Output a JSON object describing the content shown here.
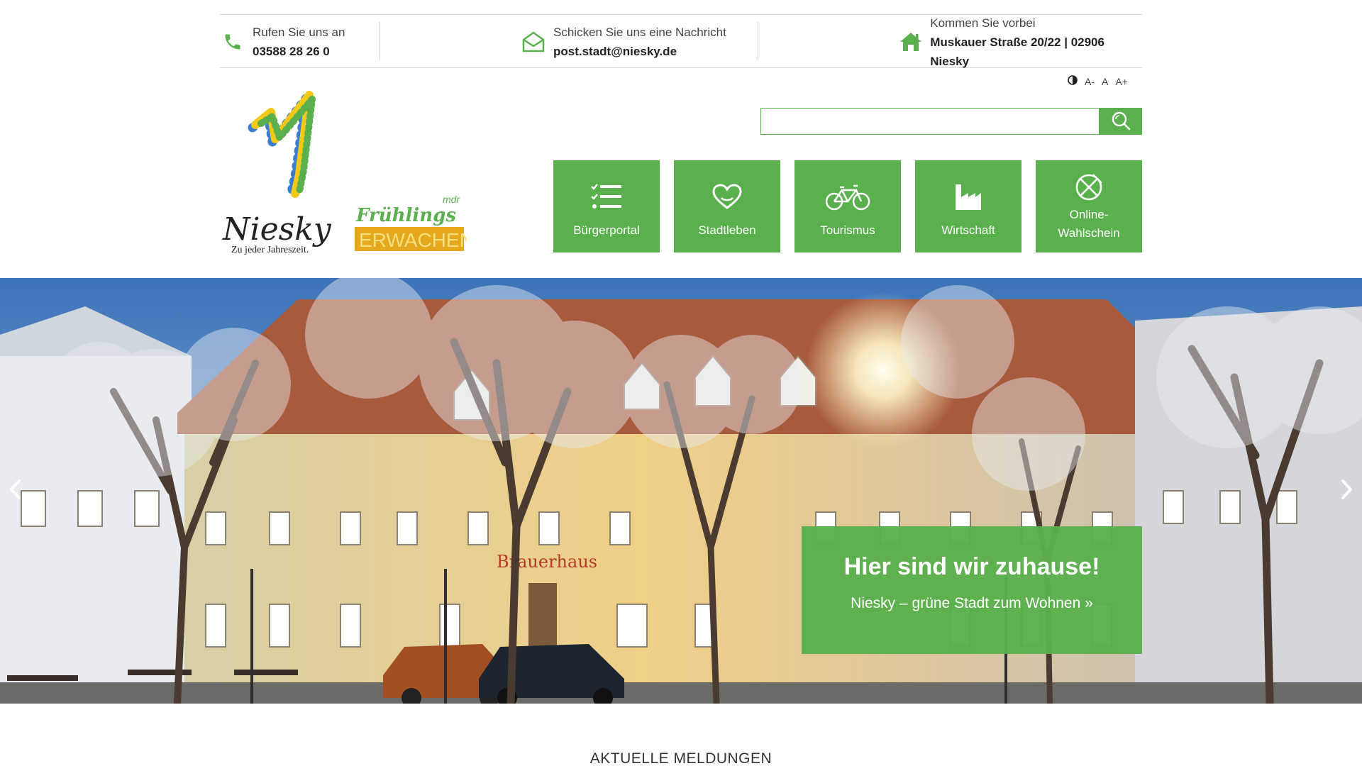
{
  "contact": {
    "phone": {
      "label": "Rufen Sie uns an",
      "value": "03588 28 26 0",
      "icon": "phone-icon"
    },
    "email": {
      "label": "Schicken Sie uns eine Nachricht",
      "value": "post.stadt@niesky.de",
      "icon": "envelope-icon"
    },
    "address": {
      "label": "Kommen Sie vorbei",
      "value": "Muskauer Straße 20/22 | 02906 Niesky",
      "icon": "home-icon"
    }
  },
  "accessibility": {
    "contrast_icon": "contrast-icon",
    "smaller": "A-",
    "normal": "A",
    "larger": "A+"
  },
  "logo": {
    "name": "Niesky",
    "tagline": "Zu jeder Jahreszeit."
  },
  "campaign_logo": {
    "top": "mdr",
    "word1": "Frühlings",
    "word2": "ERWACHEN"
  },
  "search": {
    "placeholder": "",
    "value": ""
  },
  "tiles": [
    {
      "label": "Bürgerportal",
      "icon": "checklist-icon"
    },
    {
      "label": "Stadtleben",
      "icon": "heart-icon"
    },
    {
      "label": "Tourismus",
      "icon": "bicycle-icon"
    },
    {
      "label": "Wirtschaft",
      "icon": "factory-icon"
    },
    {
      "label": "Online-Wahlschein",
      "line1": "Online-",
      "line2": "Wahlschein",
      "icon": "ballot-icon"
    }
  ],
  "hero": {
    "title": "Hier sind wir zuhause!",
    "link": "Niesky – grüne Stadt zum Wohnen  »",
    "building_sign": "Brauerhaus"
  },
  "news": {
    "heading": "AKTUELLE MELDUNGEN"
  },
  "colors": {
    "accent": "#5ab04d",
    "text": "#333333"
  }
}
